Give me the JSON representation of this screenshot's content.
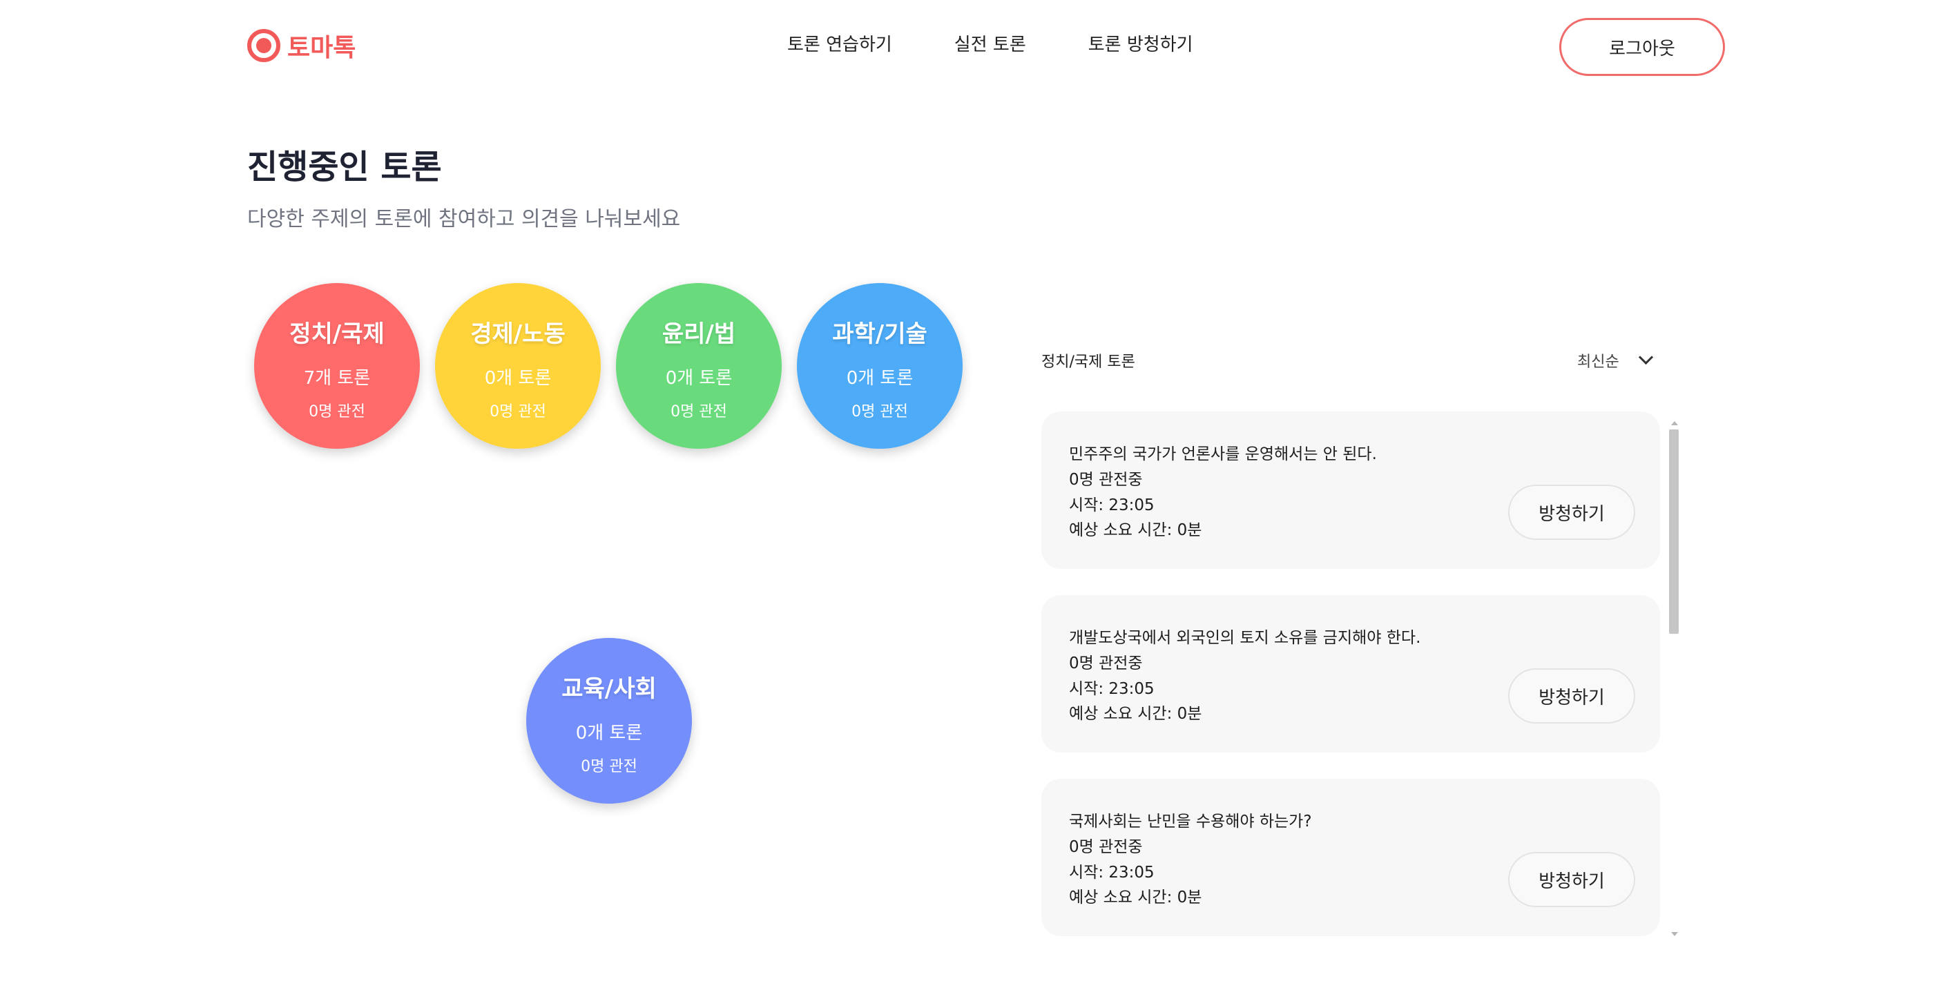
{
  "header": {
    "logo_text": "토마톡",
    "nav": [
      "토론 연습하기",
      "실전 토론",
      "토론 방청하기"
    ],
    "logout_label": "로그아웃"
  },
  "page": {
    "title": "진행중인 토론",
    "subtitle": "다양한 주제의 토론에 참여하고 의견을 나눠보세요"
  },
  "categories": [
    {
      "name": "정치/국제",
      "count": "7개 토론",
      "viewers": "0명 관전",
      "color": "#ff6b6b"
    },
    {
      "name": "경제/노동",
      "count": "0개 토론",
      "viewers": "0명 관전",
      "color": "#ffd43b"
    },
    {
      "name": "윤리/법",
      "count": "0개 토론",
      "viewers": "0명 관전",
      "color": "#69db7c"
    },
    {
      "name": "과학/기술",
      "count": "0개 토론",
      "viewers": "0명 관전",
      "color": "#4dabf7"
    },
    {
      "name": "교육/사회",
      "count": "0개 토론",
      "viewers": "0명 관전",
      "color": "#748ffc"
    }
  ],
  "panel": {
    "title": "정치/국제 토론",
    "sort_label": "최신순",
    "debates": [
      {
        "topic": "민주주의 국가가 언론사를 운영해서는 안 된다.",
        "viewers": "0명 관전중",
        "start": "시작: 23:05",
        "duration": "예상 소요 시간: 0분",
        "button": "방청하기"
      },
      {
        "topic": "개발도상국에서 외국인의 토지 소유를 금지해야 한다.",
        "viewers": "0명 관전중",
        "start": "시작: 23:05",
        "duration": "예상 소요 시간: 0분",
        "button": "방청하기"
      },
      {
        "topic": "국제사회는 난민을 수용해야 하는가?",
        "viewers": "0명 관전중",
        "start": "시작: 23:05",
        "duration": "예상 소요 시간: 0분",
        "button": "방청하기"
      }
    ]
  }
}
